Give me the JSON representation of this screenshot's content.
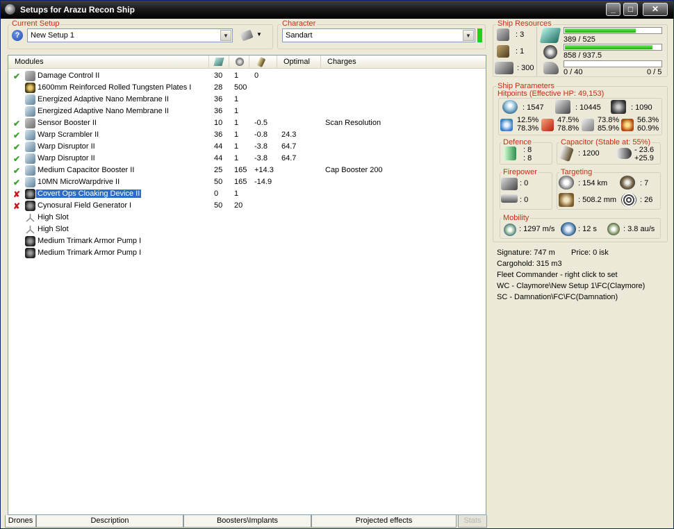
{
  "window": {
    "title": "Setups for Arazu Recon Ship",
    "minimize": "_",
    "maximize": "□",
    "close": "✕"
  },
  "current_setup": {
    "label": "Current Setup",
    "value": "New Setup 1",
    "help": "?"
  },
  "character": {
    "label": "Character",
    "value": "Sandart"
  },
  "modules": {
    "headers": {
      "name": "Modules",
      "optimal": "Optimal",
      "charges": "Charges"
    },
    "rows": [
      {
        "status": "✔",
        "name": "Damage Control II",
        "c1": "30",
        "c2": "1",
        "c3": "0",
        "optimal": "",
        "charges": ""
      },
      {
        "status": "",
        "name": "1600mm Reinforced Rolled Tungsten Plates I",
        "c1": "28",
        "c2": "500",
        "c3": "",
        "optimal": "",
        "charges": ""
      },
      {
        "status": "",
        "name": "Energized Adaptive Nano Membrane II",
        "c1": "36",
        "c2": "1",
        "c3": "",
        "optimal": "",
        "charges": ""
      },
      {
        "status": "",
        "name": "Energized Adaptive Nano Membrane II",
        "c1": "36",
        "c2": "1",
        "c3": "",
        "optimal": "",
        "charges": ""
      },
      {
        "status": "✔",
        "name": "Sensor Booster II",
        "c1": "10",
        "c2": "1",
        "c3": "-0.5",
        "optimal": "",
        "charges": "Scan Resolution"
      },
      {
        "status": "✔",
        "name": "Warp Scrambler II",
        "c1": "36",
        "c2": "1",
        "c3": "-0.8",
        "optimal": "24.3",
        "charges": ""
      },
      {
        "status": "✔",
        "name": "Warp Disruptor II",
        "c1": "44",
        "c2": "1",
        "c3": "-3.8",
        "optimal": "64.7",
        "charges": ""
      },
      {
        "status": "✔",
        "name": "Warp Disruptor II",
        "c1": "44",
        "c2": "1",
        "c3": "-3.8",
        "optimal": "64.7",
        "charges": ""
      },
      {
        "status": "✔",
        "name": "Medium Capacitor Booster II",
        "c1": "25",
        "c2": "165",
        "c3": "+14.3",
        "optimal": "",
        "charges": "Cap Booster 200"
      },
      {
        "status": "✔",
        "name": "10MN MicroWarpdrive II",
        "c1": "50",
        "c2": "165",
        "c3": "-14.9",
        "optimal": "",
        "charges": ""
      },
      {
        "status": "✘",
        "name": "Covert Ops Cloaking Device II",
        "c1": "0",
        "c2": "1",
        "c3": "",
        "optimal": "",
        "charges": ""
      },
      {
        "status": "✘",
        "name": "Cynosural Field Generator I",
        "c1": "50",
        "c2": "20",
        "c3": "",
        "optimal": "",
        "charges": ""
      },
      {
        "status": "",
        "name": "High Slot",
        "c1": "",
        "c2": "",
        "c3": "",
        "optimal": "",
        "charges": ""
      },
      {
        "status": "",
        "name": "High Slot",
        "c1": "",
        "c2": "",
        "c3": "",
        "optimal": "",
        "charges": ""
      },
      {
        "status": "",
        "name": "Medium Trimark Armor Pump I",
        "c1": "",
        "c2": "",
        "c3": "",
        "optimal": "",
        "charges": ""
      },
      {
        "status": "",
        "name": "Medium Trimark Armor Pump I",
        "c1": "",
        "c2": "",
        "c3": "",
        "optimal": "",
        "charges": ""
      }
    ]
  },
  "tabs": [
    "Drones",
    "Description",
    "Boosters\\Implants",
    "Projected effects",
    "Stats"
  ],
  "ship_resources": {
    "label": "Ship Resources",
    "turrets": ": 3",
    "launchers": ": 1",
    "calibration": ": 300",
    "cpu": "389 / 525",
    "cpu_fraction": 0.741,
    "powergrid": "858 / 937.5",
    "powergrid_fraction": 0.915,
    "drone_bay": "0 / 40",
    "drones": "0 / 5",
    "drone_fraction": 0
  },
  "ship_parameters": {
    "label": "Ship Parameters",
    "hitpoints_label": "Hitpoints (Effective HP: 49,153)",
    "shield_hp": ": 1547",
    "armor_hp": ": 10445",
    "structure_hp": ": 1090",
    "em": [
      "12.5%",
      "78.3%"
    ],
    "thermal": [
      "47.5%",
      "78.8%"
    ],
    "kinetic": [
      "73.8%",
      "85.9%"
    ],
    "explosive": [
      "56.3%",
      "60.9%"
    ],
    "defence_label": "Defence",
    "defence": [
      ": 8",
      ": 8"
    ],
    "capacitor_label": "Capacitor (Stable at: 55%)",
    "capacitor": ": 1200",
    "cap_delta": [
      "- 23.6",
      "+25.9"
    ],
    "firepower_label": "Firepower",
    "firepower": [
      ": 0",
      ": 0"
    ],
    "targeting_label": "Targeting",
    "target_range": ": 154 km",
    "max_targets": ": 7",
    "scan_res": ": 508.2 mm",
    "sensor_strength": ": 26",
    "mobility_label": "Mobility",
    "velocity": ": 1297 m/s",
    "align": ": 12 s",
    "warp": ": 3.8 au/s"
  },
  "info": {
    "signature": "Signature: 747 m",
    "price": "Price: 0 isk",
    "cargo": "Cargohold: 315 m3",
    "fleet": "Fleet Commander - right click to set",
    "wc": "WC - Claymore\\New Setup 1\\FC(Claymore)",
    "sc": "SC - Damnation\\FC\\FC(Damnation)"
  },
  "colors": {
    "label_red": "#c52e12",
    "selection": "#316ac5",
    "ok_green": "#3ca12d",
    "error_red": "#c8161d"
  }
}
